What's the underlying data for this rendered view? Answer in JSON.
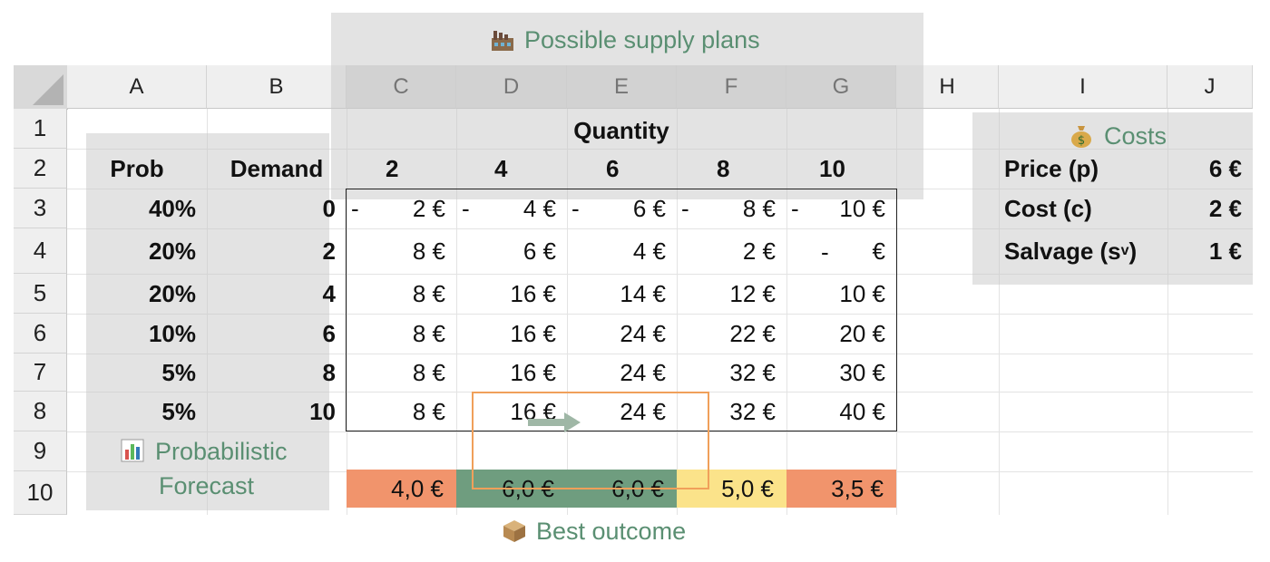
{
  "labels": {
    "supply_plans": "Possible supply plans",
    "costs": "Costs",
    "probabilistic_forecast_line1": "Probabilistic",
    "probabilistic_forecast_line2": "Forecast",
    "best_outcome": "Best outcome",
    "quantity": "Quantity"
  },
  "columns": [
    "A",
    "B",
    "C",
    "D",
    "E",
    "F",
    "G",
    "H",
    "I",
    "J"
  ],
  "rows": [
    "1",
    "2",
    "3",
    "4",
    "5",
    "6",
    "7",
    "8",
    "9",
    "10"
  ],
  "headers": {
    "prob": "Prob",
    "demand": "Demand"
  },
  "quantities": [
    "2",
    "4",
    "6",
    "8",
    "10"
  ],
  "forecast": [
    {
      "prob": "40%",
      "demand": "0"
    },
    {
      "prob": "20%",
      "demand": "2"
    },
    {
      "prob": "20%",
      "demand": "4"
    },
    {
      "prob": "10%",
      "demand": "6"
    },
    {
      "prob": "5%",
      "demand": "8"
    },
    {
      "prob": "5%",
      "demand": "10"
    }
  ],
  "payoff": [
    [
      "2 €",
      "4 €",
      "6 €",
      "8 €",
      "10 €"
    ],
    [
      "8 €",
      "6 €",
      "4 €",
      "2 €",
      "€"
    ],
    [
      "8 €",
      "16 €",
      "14 €",
      "12 €",
      "10 €"
    ],
    [
      "8 €",
      "16 €",
      "24 €",
      "22 €",
      "20 €"
    ],
    [
      "8 €",
      "16 €",
      "24 €",
      "32 €",
      "30 €"
    ],
    [
      "8 €",
      "16 €",
      "24 €",
      "32 €",
      "40 €"
    ]
  ],
  "negative_marker": "-",
  "expected": [
    "4,0 €",
    "6,0 €",
    "6,0 €",
    "5,0 €",
    "3,5 €"
  ],
  "expected_colors": [
    "#f1946c",
    "#6f9d7f",
    "#6f9d7f",
    "#fbe38a",
    "#f1946c"
  ],
  "costs": [
    {
      "label": "Price (p)",
      "value": "6 €"
    },
    {
      "label": "Cost (c)",
      "value": "2 €"
    },
    {
      "label": "Salvage (s",
      "sub": "v",
      "suffix": ")",
      "value": "1 €"
    }
  ]
}
